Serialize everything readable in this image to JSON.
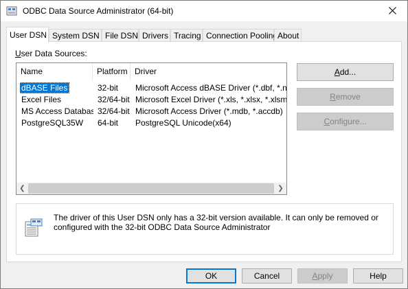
{
  "window": {
    "title": "ODBC Data Source Administrator (64-bit)"
  },
  "tabs": [
    {
      "label": "User DSN",
      "active": true
    },
    {
      "label": "System DSN"
    },
    {
      "label": "File DSN"
    },
    {
      "label": "Drivers"
    },
    {
      "label": "Tracing"
    },
    {
      "label": "Connection Pooling"
    },
    {
      "label": "About"
    }
  ],
  "panel": {
    "section_label_prefix": "U",
    "section_label_rest": "ser Data Sources:",
    "columns": [
      "Name",
      "Platform",
      "Driver"
    ],
    "rows": [
      {
        "name": "dBASE Files",
        "platform": "32-bit",
        "driver": "Microsoft Access dBASE Driver (*.dbf, *.ndx, *.mdx)",
        "selected": true
      },
      {
        "name": "Excel Files",
        "platform": "32/64-bit",
        "driver": "Microsoft Excel Driver (*.xls, *.xlsx, *.xlsm, *.xlsb)"
      },
      {
        "name": "MS Access Database",
        "platform": "32/64-bit",
        "driver": "Microsoft Access Driver (*.mdb, *.accdb)"
      },
      {
        "name": "PostgreSQL35W",
        "platform": "64-bit",
        "driver": "PostgreSQL Unicode(x64)"
      }
    ],
    "buttons": {
      "add_prefix": "A",
      "add_rest": "dd...",
      "remove_prefix": "R",
      "remove_rest": "emove",
      "configure_prefix": "C",
      "configure_rest": "onfigure..."
    },
    "info_text": "The driver of this User DSN only has a 32-bit version available. It can only be removed or configured with the 32-bit ODBC Data Source Administrator"
  },
  "footer": {
    "ok": "OK",
    "cancel": "Cancel",
    "apply_prefix": "A",
    "apply_rest": "pply",
    "help": "Help"
  },
  "colors": {
    "accent": "#0078d7",
    "selection": "#0078d7"
  }
}
